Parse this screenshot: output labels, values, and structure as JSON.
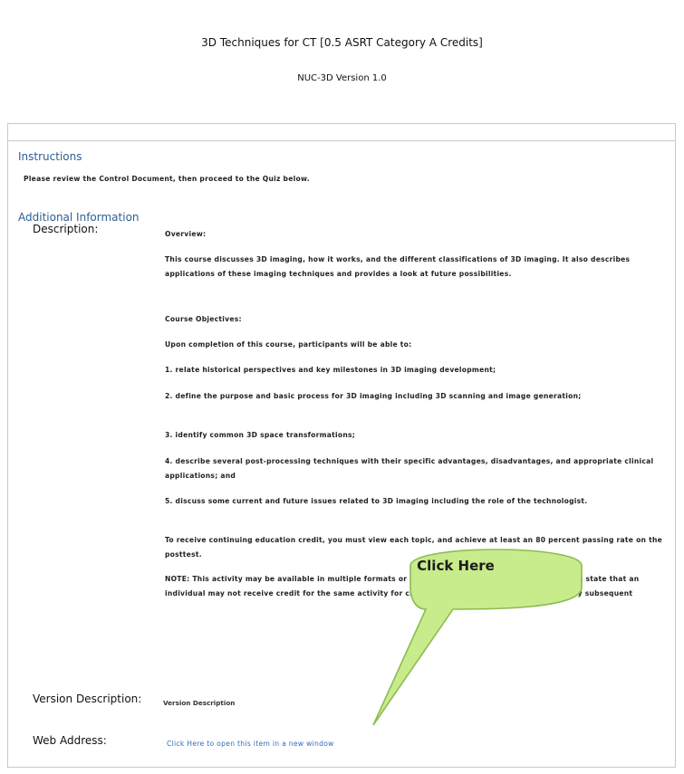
{
  "header": {
    "title": "3D Techniques for CT [0.5 ASRT Category A Credits]",
    "version_code": "NUC-3D Version 1.0"
  },
  "instructions": {
    "heading": "Instructions",
    "text": "Please review the Control Document, then proceed to the Quiz below."
  },
  "additional_info": {
    "heading": "Additional Information",
    "description_label": "Description:",
    "description_paragraphs": [
      "Overview:",
      "This course discusses 3D imaging, how it works, and the different classifications of 3D imaging. It also describes applications of these imaging techniques and provides a look at future possibilities.",
      "Course Objectives:",
      "Upon completion of this course, participants will be able to:",
      "1. relate historical perspectives and key milestones in 3D imaging development;",
      "2. define the purpose and basic process for 3D imaging including 3D scanning and image generation;",
      "3. identify common 3D space transformations;",
      "4. describe several post-processing techniques with their specific advantages, disadvantages, and appropriate clinical applications; and",
      "5. discuss some current and future issues related to 3D imaging including the role of the technologist.",
      "To receive continuing education credit, you must view each topic, and achieve at least an 80 percent passing rate on the posttest.",
      "NOTE: This activity may be available in multiple formats or from different sponsors. ARRT regulations state that an individual may not receive credit for the same activity for credit if it was reported in the same or any subsequent"
    ],
    "version_description_label": "Version Description:",
    "version_description_value": "Version Description",
    "web_address_label": "Web Address:",
    "web_address_link": "Click Here to open this item in a new window"
  },
  "callout": {
    "label": "Click Here",
    "fill_color": "#c8eb8c",
    "border_color": "#8dbb52"
  }
}
